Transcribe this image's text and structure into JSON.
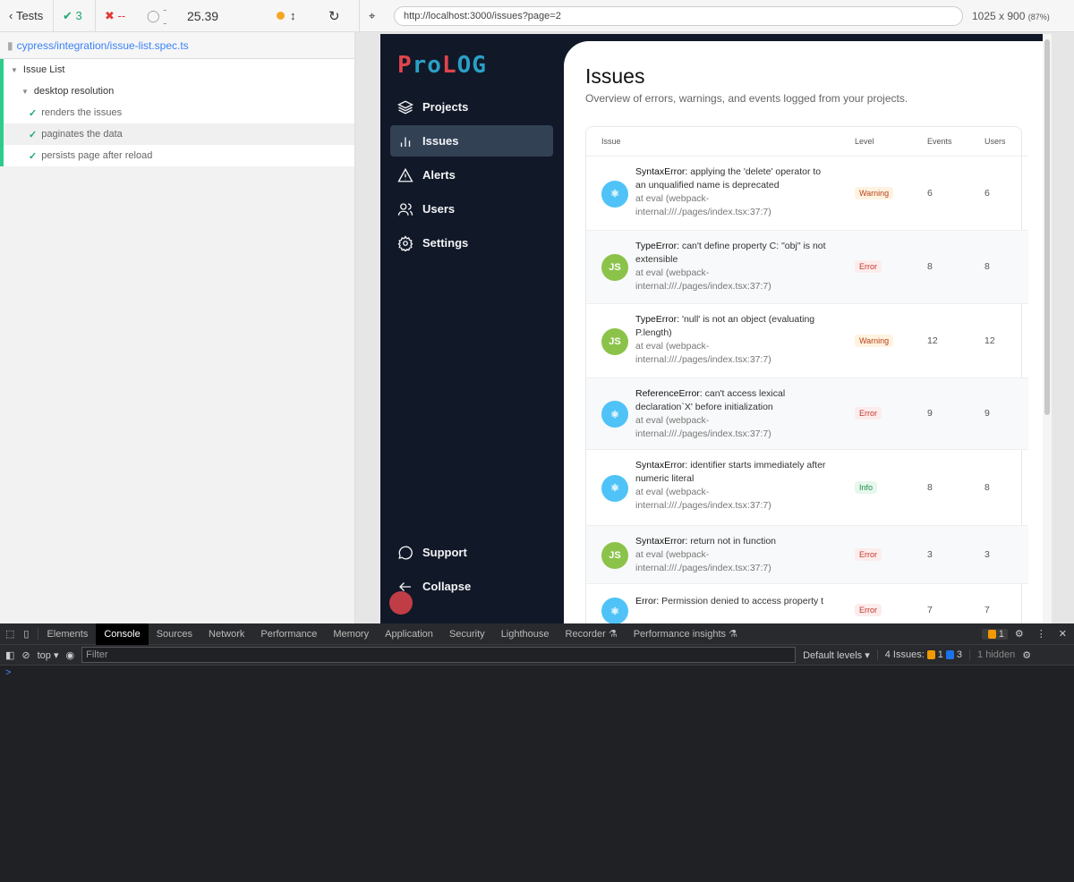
{
  "runner": {
    "back_label": "Tests",
    "passed": "3",
    "failed": "--",
    "pending": "--",
    "duration": "25.39",
    "url": "http://localhost:3000/issues?page=2",
    "viewport": "1025 x 900",
    "scale": "(87%)",
    "spec_path": "cypress/integration/issue-list.spec.ts",
    "suite": "Issue List",
    "subsuite": "desktop resolution",
    "tests": [
      "renders the issues",
      "paginates the data",
      "persists page after reload"
    ]
  },
  "app": {
    "logo": {
      "p": "P",
      "ro": "ro",
      "l": "L",
      "og": "OG"
    },
    "nav": [
      {
        "label": "Projects",
        "icon": "layers-icon"
      },
      {
        "label": "Issues",
        "icon": "bar-chart-icon",
        "active": true
      },
      {
        "label": "Alerts",
        "icon": "alert-triangle-icon"
      },
      {
        "label": "Users",
        "icon": "users-icon"
      },
      {
        "label": "Settings",
        "icon": "gear-icon"
      }
    ],
    "support": "Support",
    "collapse": "Collapse",
    "title": "Issues",
    "subtitle": "Overview of errors, warnings, and events logged from your projects.",
    "columns": {
      "issue": "Issue",
      "level": "Level",
      "events": "Events",
      "users": "Users"
    },
    "rows": [
      {
        "type": "SyntaxError:",
        "message": "applying the 'delete' operator to an unqualified name is deprecated",
        "location": "at eval (webpack-internal:///./pages/index.tsx:37:7)",
        "level": "Warning",
        "events": "6",
        "users": "6",
        "icon": "react"
      },
      {
        "type": "TypeError:",
        "message": "can't define property C: \"obj\" is not extensible",
        "location": "at eval (webpack-internal:///./pages/index.tsx:37:7)",
        "level": "Error",
        "events": "8",
        "users": "8",
        "icon": "node"
      },
      {
        "type": "TypeError:",
        "message": "'null' is not an object (evaluating P.length)",
        "location": "at eval (webpack-internal:///./pages/index.tsx:37:7)",
        "level": "Warning",
        "events": "12",
        "users": "12",
        "icon": "node"
      },
      {
        "type": "ReferenceError:",
        "message": "can't access lexical declaration`X' before initialization",
        "location": "at eval (webpack-internal:///./pages/index.tsx:37:7)",
        "level": "Error",
        "events": "9",
        "users": "9",
        "icon": "react"
      },
      {
        "type": "SyntaxError:",
        "message": "identifier starts immediately after numeric literal",
        "location": "at eval (webpack-internal:///./pages/index.tsx:37:7)",
        "level": "Info",
        "events": "8",
        "users": "8",
        "icon": "react"
      },
      {
        "type": "SyntaxError:",
        "message": "return not in function",
        "location": "at eval (webpack-internal:///./pages/index.tsx:37:7)",
        "level": "Error",
        "events": "3",
        "users": "3",
        "icon": "node"
      },
      {
        "type": "Error:",
        "message": "Permission denied to access property t",
        "location": "",
        "level": "Error",
        "events": "7",
        "users": "7",
        "icon": "react"
      }
    ]
  },
  "devtools": {
    "tabs": [
      "Elements",
      "Console",
      "Sources",
      "Network",
      "Performance",
      "Memory",
      "Application",
      "Security",
      "Lighthouse",
      "Recorder ⚗",
      "Performance insights ⚗"
    ],
    "active_tab": "Console",
    "warning_count": "1",
    "context": "top",
    "filter_placeholder": "Filter",
    "levels": "Default levels",
    "issues_label": "4 Issues:",
    "issues_warn": "1",
    "issues_info": "3",
    "hidden": "1 hidden",
    "prompt": ">"
  },
  "colors": {
    "accent_green": "#1fa971",
    "sidebar_bg": "#111827",
    "active_nav": "#334155",
    "logo_red": "#e0444c",
    "logo_blue": "#2b9fc7"
  }
}
